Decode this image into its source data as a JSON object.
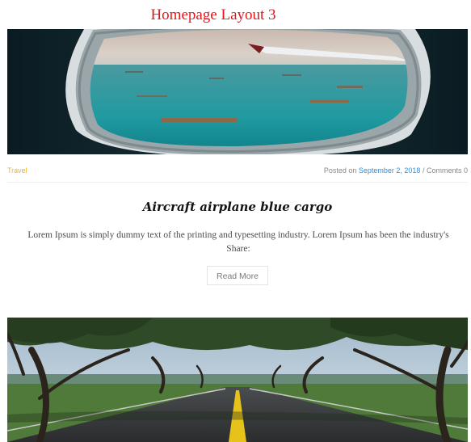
{
  "page": {
    "layout_title": "Homepage Layout 3"
  },
  "post1": {
    "category": "Travel",
    "posted_on_label": "Posted on",
    "date": "September 2, 2018",
    "separator": "/",
    "comments": "Comments 0",
    "title": "Aircraft airplane blue cargo",
    "excerpt": "Lorem Ipsum is simply dummy text of the printing and typesetting industry. Lorem Ipsum has been the industry's Share:",
    "read_more": "Read More"
  },
  "colors": {
    "layout_title": "#e8141b",
    "category": "#f5b21b",
    "date_link": "#2d8fe0"
  }
}
